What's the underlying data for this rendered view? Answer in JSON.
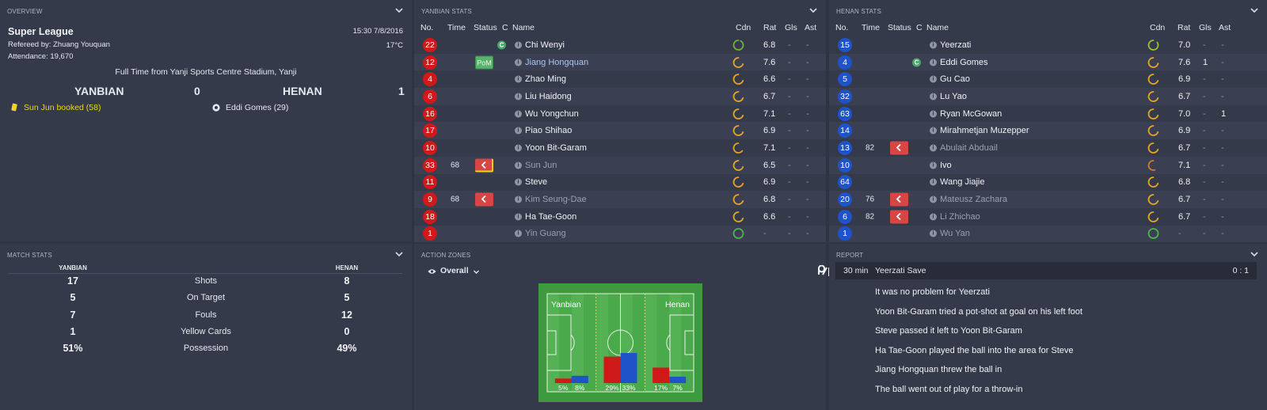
{
  "overview": {
    "title": "OVERVIEW",
    "competition": "Super League",
    "referee": "Refereed by: Zhuang Youquan",
    "attendance": "Attendance: 19,670",
    "datetime": "15:30 7/8/2016",
    "temperature": "17°C",
    "venue": "Full Time from Yanji Sports Centre Stadium, Yanji",
    "home_team": "YANBIAN",
    "home_score": "0",
    "away_team": "HENAN",
    "away_score": "1",
    "home_event": "Sun Jun booked (58)",
    "away_event": "Eddi Gomes (29)"
  },
  "yanbian": {
    "title": "YANBIAN STATS",
    "headers": {
      "no": "No.",
      "time": "Time",
      "status": "Status",
      "c": "C",
      "name": "Name",
      "cdn": "Cdn",
      "rat": "Rat",
      "gls": "Gls",
      "ast": "Ast"
    },
    "players": [
      {
        "no": "22",
        "time": "",
        "status": "",
        "captain": true,
        "name": "Chi Wenyi",
        "style": "normal",
        "cdn": 0.92,
        "cdn_color": "#6db33f",
        "rat": "6.8",
        "gls": "-",
        "ast": "-"
      },
      {
        "no": "12",
        "time": "",
        "status": "pom",
        "pom_label": "PoM",
        "captain": false,
        "name": "Jiang Hongquan",
        "style": "hl",
        "cdn": 0.7,
        "cdn_color": "#e3a52a",
        "rat": "7.6",
        "gls": "-",
        "ast": "-"
      },
      {
        "no": "4",
        "time": "",
        "status": "",
        "captain": false,
        "name": "Zhao Ming",
        "style": "normal",
        "cdn": 0.7,
        "cdn_color": "#e3a52a",
        "rat": "6.6",
        "gls": "-",
        "ast": "-"
      },
      {
        "no": "6",
        "time": "",
        "status": "",
        "captain": false,
        "name": "Liu Haidong",
        "style": "normal",
        "cdn": 0.7,
        "cdn_color": "#e3a52a",
        "rat": "6.7",
        "gls": "-",
        "ast": "-"
      },
      {
        "no": "16",
        "time": "",
        "status": "",
        "captain": false,
        "name": "Wu Yongchun",
        "style": "normal",
        "cdn": 0.7,
        "cdn_color": "#e3a52a",
        "rat": "7.1",
        "gls": "-",
        "ast": "-"
      },
      {
        "no": "17",
        "time": "",
        "status": "",
        "captain": false,
        "name": "Piao Shihao",
        "style": "normal",
        "cdn": 0.7,
        "cdn_color": "#e3a52a",
        "rat": "6.9",
        "gls": "-",
        "ast": "-"
      },
      {
        "no": "10",
        "time": "",
        "status": "",
        "captain": false,
        "name": "Yoon Bit-Garam",
        "style": "normal",
        "cdn": 0.65,
        "cdn_color": "#e3a52a",
        "rat": "7.1",
        "gls": "-",
        "ast": "-"
      },
      {
        "no": "33",
        "time": "68",
        "status": "sub-booked",
        "captain": false,
        "name": "Sun Jun",
        "style": "sub",
        "cdn": 0.7,
        "cdn_color": "#e3a52a",
        "rat": "6.5",
        "gls": "-",
        "ast": "-"
      },
      {
        "no": "11",
        "time": "",
        "status": "",
        "captain": false,
        "name": "Steve",
        "style": "normal",
        "cdn": 0.7,
        "cdn_color": "#e3a52a",
        "rat": "6.9",
        "gls": "-",
        "ast": "-"
      },
      {
        "no": "9",
        "time": "68",
        "status": "sub",
        "captain": false,
        "name": "Kim Seung-Dae",
        "style": "sub",
        "cdn": 0.7,
        "cdn_color": "#e3a52a",
        "rat": "6.8",
        "gls": "-",
        "ast": "-"
      },
      {
        "no": "18",
        "time": "",
        "status": "",
        "captain": false,
        "name": "Ha Tae-Goon",
        "style": "normal",
        "cdn": 0.7,
        "cdn_color": "#e3a52a",
        "rat": "6.6",
        "gls": "-",
        "ast": "-"
      },
      {
        "no": "1",
        "time": "",
        "status": "",
        "captain": false,
        "name": "Yin Guang",
        "style": "sub",
        "cdn": 1.0,
        "cdn_color": "#4fb24f",
        "rat": "-",
        "gls": "-",
        "ast": "-"
      }
    ]
  },
  "henan": {
    "title": "HENAN STATS",
    "headers": {
      "no": "No.",
      "time": "Time",
      "status": "Status",
      "c": "C",
      "name": "Name",
      "cdn": "Cdn",
      "rat": "Rat",
      "gls": "Gls",
      "ast": "Ast"
    },
    "players": [
      {
        "no": "15",
        "time": "",
        "status": "",
        "captain": false,
        "name": "Yeerzati",
        "style": "normal",
        "cdn": 0.85,
        "cdn_color": "#9cbf3b",
        "rat": "7.0",
        "gls": "-",
        "ast": "-"
      },
      {
        "no": "4",
        "time": "",
        "status": "",
        "captain": true,
        "name": "Eddi Gomes",
        "style": "normal",
        "cdn": 0.72,
        "cdn_color": "#e3a52a",
        "rat": "7.6",
        "gls": "1",
        "ast": "-"
      },
      {
        "no": "5",
        "time": "",
        "status": "",
        "captain": false,
        "name": "Gu Cao",
        "style": "normal",
        "cdn": 0.7,
        "cdn_color": "#e3a52a",
        "rat": "6.9",
        "gls": "-",
        "ast": "-"
      },
      {
        "no": "32",
        "time": "",
        "status": "",
        "captain": false,
        "name": "Lu Yao",
        "style": "normal",
        "cdn": 0.7,
        "cdn_color": "#e3a52a",
        "rat": "6.7",
        "gls": "-",
        "ast": "-"
      },
      {
        "no": "63",
        "time": "",
        "status": "",
        "captain": false,
        "name": "Ryan McGowan",
        "style": "normal",
        "cdn": 0.7,
        "cdn_color": "#e3a52a",
        "rat": "7.0",
        "gls": "-",
        "ast": "1"
      },
      {
        "no": "14",
        "time": "",
        "status": "",
        "captain": false,
        "name": "Mirahmetjan Muzepper",
        "style": "normal",
        "cdn": 0.7,
        "cdn_color": "#e3a52a",
        "rat": "6.9",
        "gls": "-",
        "ast": "-"
      },
      {
        "no": "13",
        "time": "82",
        "status": "sub",
        "captain": false,
        "name": "Abulait Abduail",
        "style": "sub",
        "cdn": 0.7,
        "cdn_color": "#e3a52a",
        "rat": "6.7",
        "gls": "-",
        "ast": "-"
      },
      {
        "no": "10",
        "time": "",
        "status": "",
        "captain": false,
        "name": "Ivo",
        "style": "normal",
        "cdn": 0.55,
        "cdn_color": "#d9782a",
        "rat": "7.1",
        "gls": "-",
        "ast": "-"
      },
      {
        "no": "64",
        "time": "",
        "status": "",
        "captain": false,
        "name": "Wang Jiajie",
        "style": "normal",
        "cdn": 0.7,
        "cdn_color": "#e3a52a",
        "rat": "6.8",
        "gls": "-",
        "ast": "-"
      },
      {
        "no": "20",
        "time": "76",
        "status": "sub",
        "captain": false,
        "name": "Mateusz Zachara",
        "style": "sub",
        "cdn": 0.7,
        "cdn_color": "#e3a52a",
        "rat": "6.7",
        "gls": "-",
        "ast": "-"
      },
      {
        "no": "6",
        "time": "82",
        "status": "sub",
        "captain": false,
        "name": "Li Zhichao",
        "style": "sub",
        "cdn": 0.7,
        "cdn_color": "#e3a52a",
        "rat": "6.7",
        "gls": "-",
        "ast": "-"
      },
      {
        "no": "1",
        "time": "",
        "status": "",
        "captain": false,
        "name": "Wu Yan",
        "style": "sub",
        "cdn": 1.0,
        "cdn_color": "#4fb24f",
        "rat": "-",
        "gls": "-",
        "ast": "-"
      }
    ]
  },
  "match_stats": {
    "title": "MATCH STATS",
    "home": "YANBIAN",
    "away": "HENAN",
    "rows": [
      {
        "label": "Shots",
        "home": "17",
        "away": "8"
      },
      {
        "label": "On Target",
        "home": "5",
        "away": "5"
      },
      {
        "label": "Fouls",
        "home": "7",
        "away": "12"
      },
      {
        "label": "Yellow Cards",
        "home": "1",
        "away": "0"
      },
      {
        "label": "Possession",
        "home": "51%",
        "away": "49%"
      }
    ]
  },
  "action_zones": {
    "title": "ACTION ZONES",
    "view": "Overall",
    "brand": "prozone",
    "home_label": "Yanbian",
    "away_label": "Henan",
    "home_color": "#d01919",
    "away_color": "#1e53c9",
    "zones": [
      {
        "home": 5,
        "away": 8,
        "home_label": "5%",
        "away_label": "8%"
      },
      {
        "home": 29,
        "away": 33,
        "home_label": "29%",
        "away_label": "33%"
      },
      {
        "home": 17,
        "away": 7,
        "home_label": "17%",
        "away_label": "7%"
      }
    ]
  },
  "report": {
    "title": "REPORT",
    "event_time": "30 min",
    "event_title": "Yeerzati Save",
    "event_score": "0 : 1",
    "lines": [
      "It was no problem for Yeerzati",
      "Yoon Bit-Garam tried a pot-shot at goal on his left foot",
      "Steve passed it left to Yoon Bit-Garam",
      "Ha Tae-Goon played the ball into the area for Steve",
      "Jiang Hongquan threw the ball in",
      "The ball went out of play for a throw-in"
    ]
  }
}
